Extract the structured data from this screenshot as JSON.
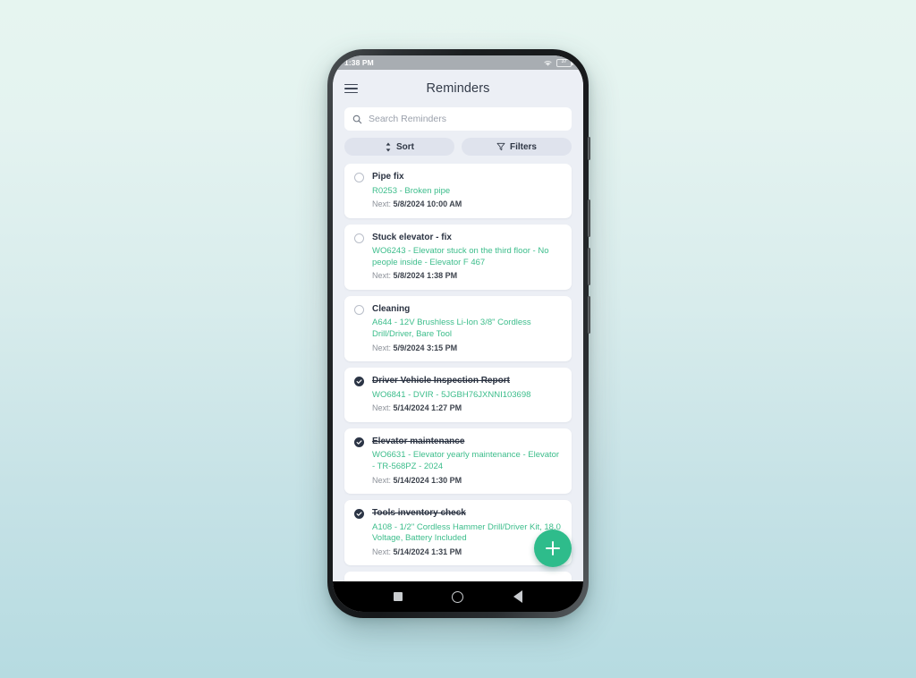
{
  "status_bar": {
    "time": "1:38 PM",
    "wifi_icon": "wifi-icon",
    "battery_level": "37"
  },
  "header": {
    "menu_icon": "hamburger-menu-icon",
    "title": "Reminders"
  },
  "search": {
    "icon": "search-icon",
    "placeholder": "Search Reminders",
    "value": ""
  },
  "toolbar": {
    "sort_label": "Sort",
    "sort_icon": "sort-updown-icon",
    "filters_label": "Filters",
    "filters_icon": "filter-funnel-icon"
  },
  "fab": {
    "icon": "plus-icon",
    "label": "Add reminder"
  },
  "nav_bar": {
    "recents_icon": "square-recents-icon",
    "home_icon": "circle-home-icon",
    "back_icon": "triangle-back-icon"
  },
  "colors": {
    "accent_green": "#2ebc8b",
    "link_green": "#3cbd8b",
    "title_navy": "#2b3342",
    "screen_bg": "#eceff5",
    "chip_bg": "#dfe3ed"
  },
  "reminders": [
    {
      "title": "Pipe fix",
      "subtitle": "R0253 - Broken pipe",
      "next_label": "Next:",
      "next_value": "5/8/2024 10:00 AM",
      "completed": false
    },
    {
      "title": "Stuck elevator - fix",
      "subtitle": "WO6243 - Elevator stuck on the third floor - No people inside - Elevator F 467",
      "next_label": "Next:",
      "next_value": "5/8/2024 1:38 PM",
      "completed": false
    },
    {
      "title": "Cleaning",
      "subtitle": "A644 - 12V Brushless Li-Ion 3/8\" Cordless Drill/Driver, Bare Tool",
      "next_label": "Next:",
      "next_value": "5/9/2024 3:15 PM",
      "completed": false
    },
    {
      "title": "Driver Vehicle Inspection Report",
      "subtitle": "WO6841 - DVIR - 5JGBH76JXNNI103698",
      "next_label": "Next:",
      "next_value": "5/14/2024 1:27 PM",
      "completed": true
    },
    {
      "title": "Elevator maintenance",
      "subtitle": "WO6631 - Elevator yearly maintenance - Elevator - TR-568PZ - 2024",
      "next_label": "Next:",
      "next_value": "5/14/2024 1:30 PM",
      "completed": true
    },
    {
      "title": "Tools inventory check",
      "subtitle": "A108 - 1/2\" Cordless Hammer Drill/Driver Kit, 18.0 Voltage, Battery Included",
      "next_label": "Next:",
      "next_value": "5/14/2024 1:31 PM",
      "completed": true
    }
  ]
}
